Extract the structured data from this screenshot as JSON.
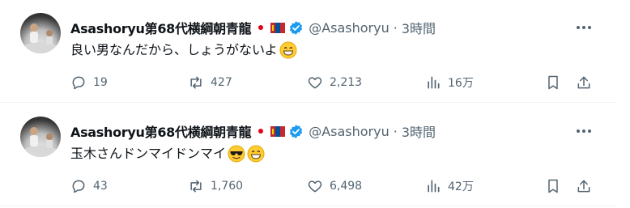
{
  "icons": {
    "flag_japan": "flag-japan-icon",
    "flag_mongolia": "flag-mongolia-icon",
    "verified": "verified-badge-icon",
    "more": "more-options-icon",
    "reply": "reply-icon",
    "retweet": "retweet-icon",
    "like": "like-icon",
    "views": "views-icon",
    "bookmark": "bookmark-icon",
    "share": "share-icon"
  },
  "colors": {
    "verified": "#1d9bf0",
    "muted": "#536471",
    "text": "#0f1419"
  },
  "tweets": [
    {
      "name": "Asashoryu第68代横綱朝青龍",
      "handle": "@Asashoryu",
      "separator": "·",
      "time": "3時間",
      "text": "良い男なんだから、しょうがないよ",
      "emojis": [
        "grinning-face"
      ],
      "replies": "19",
      "retweets": "427",
      "likes": "2,213",
      "views": "16万"
    },
    {
      "name": "Asashoryu第68代横綱朝青龍",
      "handle": "@Asashoryu",
      "separator": "·",
      "time": "3時間",
      "text": "玉木さんドンマイドンマイ",
      "emojis": [
        "sunglasses-face",
        "grinning-face"
      ],
      "replies": "43",
      "retweets": "1,760",
      "likes": "6,498",
      "views": "42万"
    }
  ]
}
